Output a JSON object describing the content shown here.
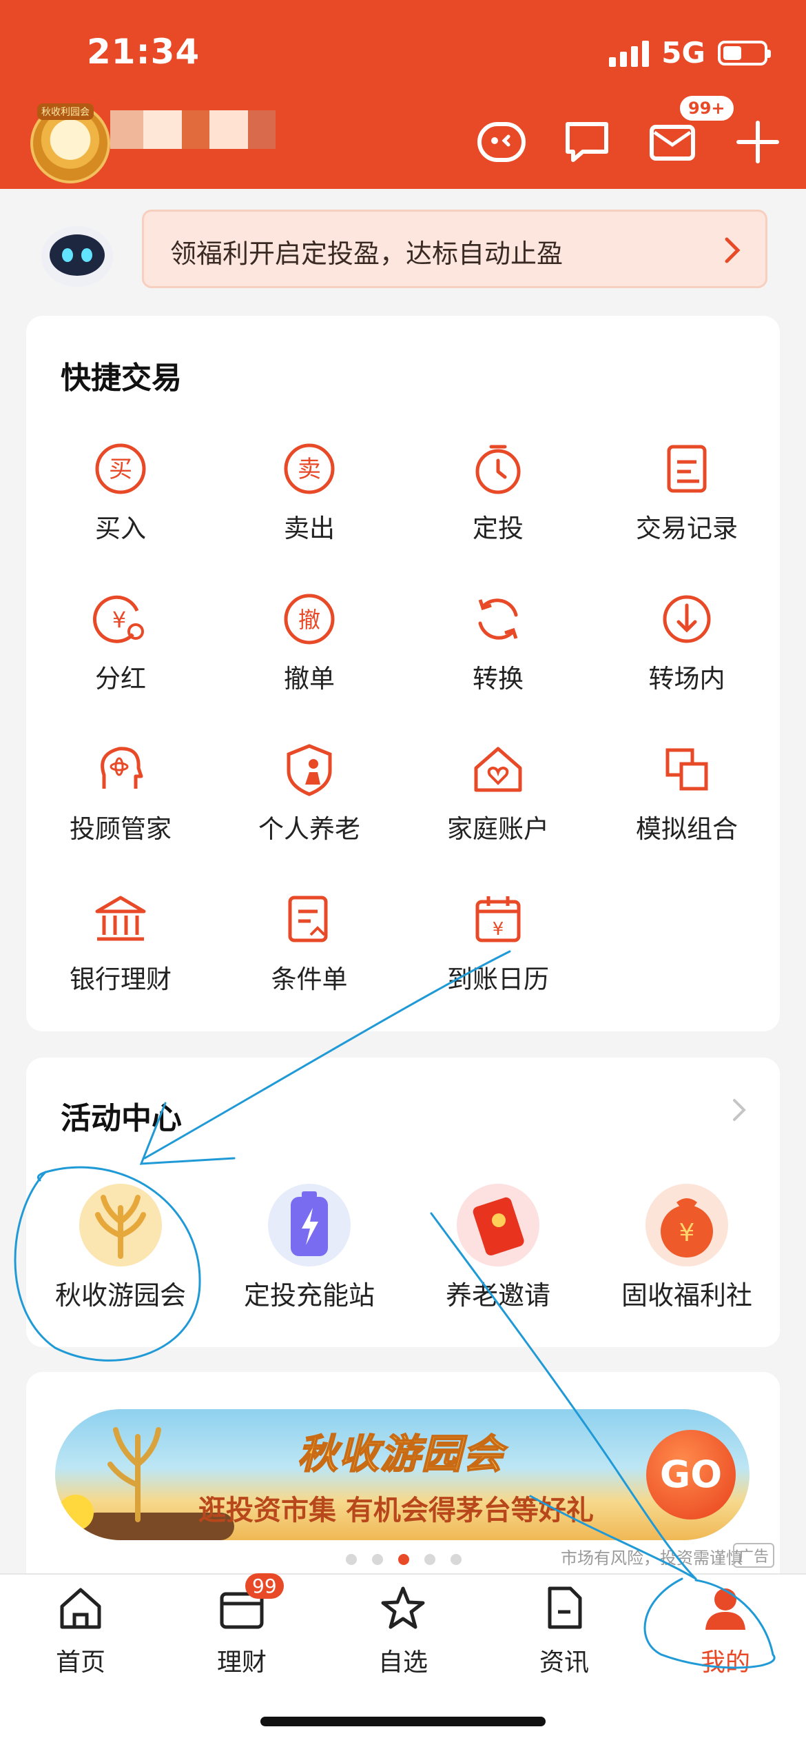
{
  "status_bar": {
    "time": "21:34",
    "network": "5G",
    "battery_level": 0.45
  },
  "header": {
    "avatar_badge": "秋收利园会",
    "message_badge": "99+",
    "icons": [
      "service-icon",
      "chat-icon",
      "mail-icon",
      "plus-icon"
    ]
  },
  "notice": {
    "text": "领福利开启定投盈，达标自动止盈"
  },
  "quick_trade": {
    "title": "快捷交易",
    "items": [
      {
        "label": "买入",
        "icon": "buy-icon",
        "glyph": "买"
      },
      {
        "label": "卖出",
        "icon": "sell-icon",
        "glyph": "卖"
      },
      {
        "label": "定投",
        "icon": "timer-icon",
        "glyph": ""
      },
      {
        "label": "交易记录",
        "icon": "record-icon",
        "glyph": ""
      },
      {
        "label": "分红",
        "icon": "dividend-icon",
        "glyph": "¥"
      },
      {
        "label": "撤单",
        "icon": "cancel-order-icon",
        "glyph": "撤"
      },
      {
        "label": "转换",
        "icon": "convert-icon",
        "glyph": ""
      },
      {
        "label": "转场内",
        "icon": "transfer-in-icon",
        "glyph": ""
      },
      {
        "label": "投顾管家",
        "icon": "advisor-icon",
        "glyph": ""
      },
      {
        "label": "个人养老",
        "icon": "pension-icon",
        "glyph": ""
      },
      {
        "label": "家庭账户",
        "icon": "family-account-icon",
        "glyph": ""
      },
      {
        "label": "模拟组合",
        "icon": "simulation-icon",
        "glyph": ""
      },
      {
        "label": "银行理财",
        "icon": "bank-icon",
        "glyph": ""
      },
      {
        "label": "条件单",
        "icon": "condition-order-icon",
        "glyph": ""
      },
      {
        "label": "到账日历",
        "icon": "calendar-icon",
        "glyph": "¥"
      }
    ]
  },
  "activity": {
    "title": "活动中心",
    "items": [
      {
        "label": "秋收游园会",
        "icon": "wheat-icon"
      },
      {
        "label": "定投充能站",
        "icon": "battery-icon"
      },
      {
        "label": "养老邀请",
        "icon": "red-envelope-icon"
      },
      {
        "label": "固收福利社",
        "icon": "money-bag-icon"
      }
    ]
  },
  "banner": {
    "title": "秋收游园会",
    "subtitle": "逛投资市集 有机会得茅台等好礼",
    "button": "GO",
    "risk": "市场有风险，投资需谨慎",
    "ad": "广告",
    "dots_total": 5,
    "dots_active": 3
  },
  "tabbar": {
    "tabs": [
      {
        "label": "首页",
        "icon": "home-icon"
      },
      {
        "label": "理财",
        "icon": "wallet-icon",
        "badge": "99"
      },
      {
        "label": "自选",
        "icon": "star-icon"
      },
      {
        "label": "资讯",
        "icon": "news-icon"
      },
      {
        "label": "我的",
        "icon": "profile-icon"
      }
    ],
    "active": "我的"
  },
  "colors": {
    "brand": "#e84a28",
    "background": "#f4f4f4",
    "annotation": "#1f9ad6"
  }
}
